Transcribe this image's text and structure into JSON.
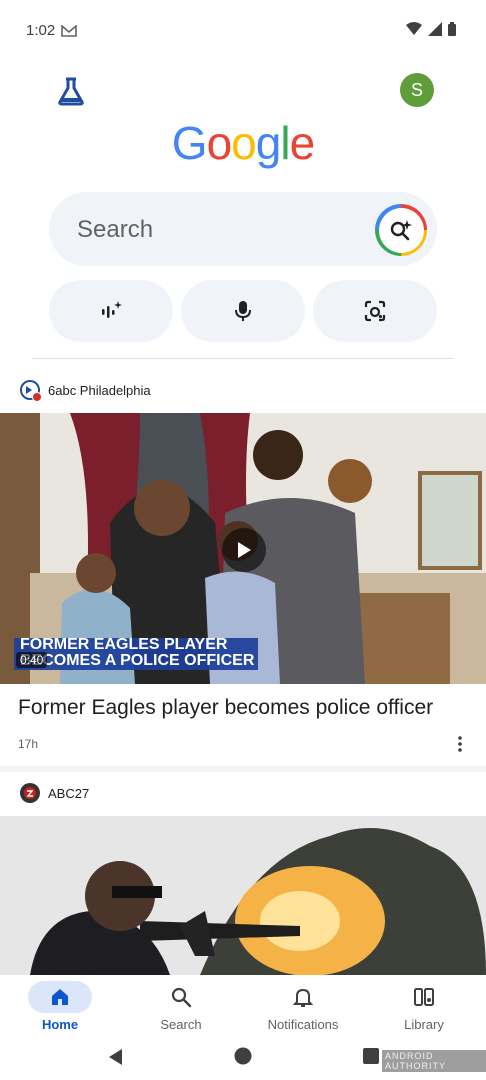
{
  "status_bar": {
    "time": "1:02"
  },
  "header": {
    "avatar_letter": "S"
  },
  "logo": {
    "letters": [
      "G",
      "o",
      "o",
      "g",
      "l",
      "e"
    ],
    "colors": [
      "#4285f4",
      "#ea4335",
      "#fbbc05",
      "#4285f4",
      "#34a853",
      "#ea4335"
    ]
  },
  "search": {
    "placeholder": "Search"
  },
  "feed": [
    {
      "source": "6abc Philadelphia",
      "overlay_line1": "FORMER EAGLES PLAYER",
      "overlay_line2": "BECOMES A POLICE OFFICER",
      "duration": "0:40",
      "title": "Former Eagles player becomes police officer",
      "age": "17h"
    },
    {
      "source": "ABC27"
    }
  ],
  "bottom_nav": [
    {
      "label": "Home",
      "icon": "home-icon",
      "active": true
    },
    {
      "label": "Search",
      "icon": "search-icon",
      "active": false
    },
    {
      "label": "Notifications",
      "icon": "bell-icon",
      "active": false
    },
    {
      "label": "Library",
      "icon": "library-icon",
      "active": false
    }
  ],
  "watermark": "ANDROID AUTHORITY",
  "colors": {
    "accent": "#0b57d0",
    "surface": "#f0f4f9"
  }
}
